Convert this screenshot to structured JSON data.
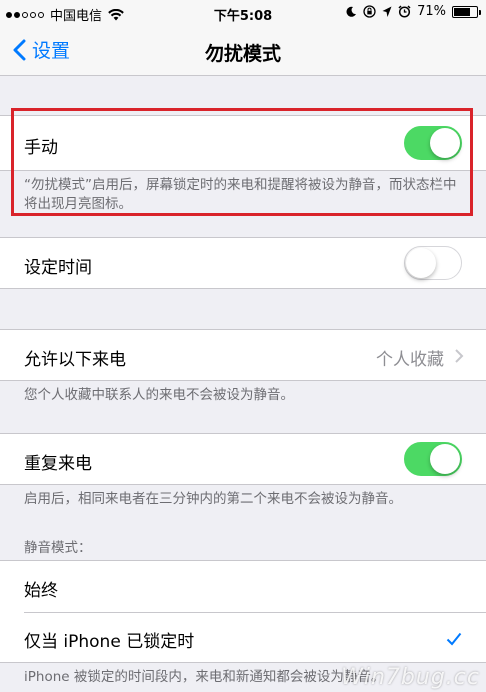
{
  "status_bar": {
    "carrier": "中国电信",
    "time": "下午5:08",
    "battery": "71%",
    "battery_level": 0.71
  },
  "nav": {
    "back_label": "设置",
    "title": "勿扰模式"
  },
  "manual": {
    "label": "手动",
    "enabled": true,
    "footer": "“勿扰模式”启用后，屏幕锁定时的来电和提醒将被设为静音，而状态栏中将出现月亮图标。"
  },
  "scheduled": {
    "label": "设定时间",
    "enabled": false
  },
  "allow_calls": {
    "label": "允许以下来电",
    "value": "个人收藏",
    "footer": "您个人收藏中联系人的来电不会被设为静音。"
  },
  "repeated_calls": {
    "label": "重复来电",
    "enabled": true,
    "footer": "启用后，相同来电者在三分钟内的第二个来电不会被设为静音。"
  },
  "silence": {
    "header": "静音模式：",
    "options": [
      "始终",
      "仅当 iPhone 已锁定时"
    ],
    "selected": "仅当 iPhone 已锁定时",
    "footer": "iPhone 被锁定的时间段内，来电和新通知都会被设为静音。"
  },
  "watermark": "Win7bug.cc",
  "colors": {
    "accent": "#007aff",
    "toggle_on": "#4cd964",
    "highlight": "#d9232a"
  }
}
